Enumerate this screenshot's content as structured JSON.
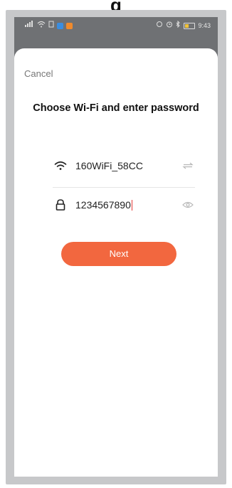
{
  "header": {
    "partial_caption": "g"
  },
  "statusbar": {
    "left_icons": [
      "signal-icon",
      "wifi-icon",
      "sim-icon",
      "app-icon-blue",
      "app-icon-orange"
    ],
    "right_icons": [
      "notification-icon",
      "alarm-icon",
      "bluetooth-icon",
      "battery-icon"
    ],
    "time": "9:43"
  },
  "dialog": {
    "cancel_label": "Cancel",
    "title": "Choose Wi-Fi and enter password",
    "wifi_name": "160WiFi_58CC",
    "password_value": "1234567890",
    "next_label": "Next"
  },
  "colors": {
    "accent": "#f2673f",
    "caret": "#e53935",
    "frame": "#c7c8ca",
    "device_bg": "#6f7174"
  }
}
